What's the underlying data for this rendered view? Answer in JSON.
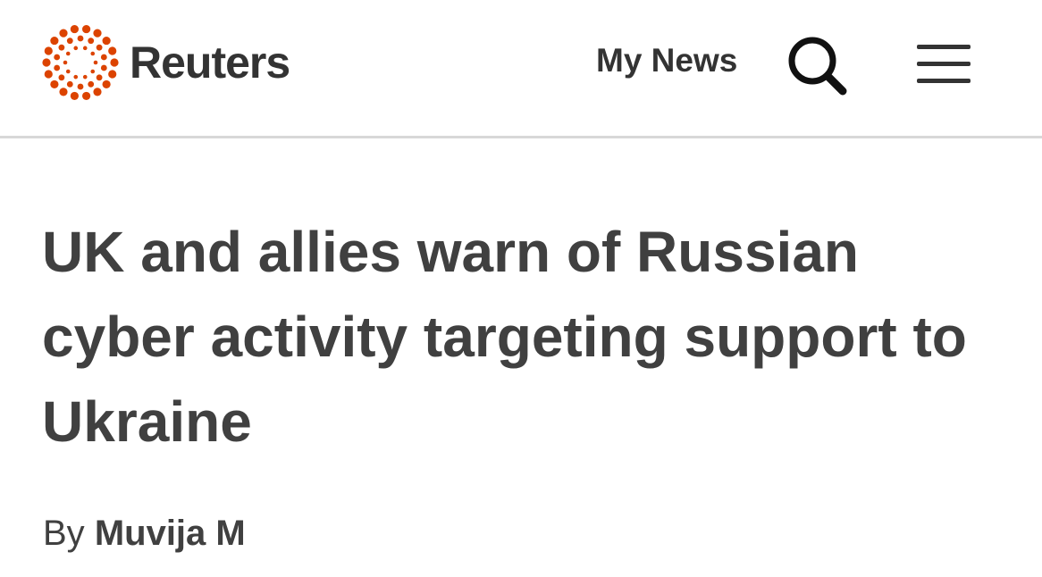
{
  "header": {
    "brand": "Reuters",
    "brand_color": "#dc4300",
    "my_news_label": "My News",
    "search_icon": "search-icon",
    "menu_icon": "hamburger-menu-icon"
  },
  "article": {
    "headline": "UK and allies warn of Russian cyber activity targeting support to Ukraine",
    "byline_prefix": "By",
    "author": "Muvija M"
  }
}
